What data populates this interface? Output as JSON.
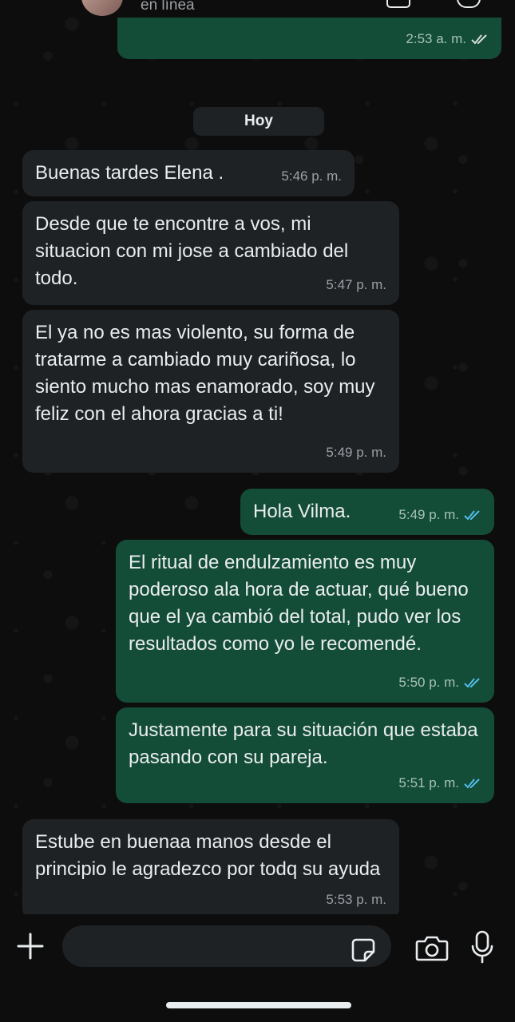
{
  "header": {
    "status": "en línea"
  },
  "date_separator": "Hoy",
  "messages": [
    {
      "direction": "out",
      "text": "",
      "time": "2:53 a. m."
    },
    {
      "direction": "in",
      "text": "Buenas tardes Elena .",
      "time": "5:46 p. m."
    },
    {
      "direction": "in",
      "text": "Desde que te encontre a vos, mi situacion con mi jose a cambiado del todo.",
      "time": "5:47 p. m."
    },
    {
      "direction": "in",
      "text": "El ya no es mas violento, su forma de tratarme a cambiado muy cariñosa, lo siento mucho mas enamorado, soy muy feliz con el ahora gracias a ti!",
      "time": "5:49 p. m."
    },
    {
      "direction": "out",
      "text": "Hola Vilma.",
      "time": "5:49 p. m."
    },
    {
      "direction": "out",
      "text": "El ritual de endulzamiento es muy poderoso ala hora de actuar, qué bueno que el ya cambió del total, pudo ver los resultados como yo le recomendé.",
      "time": "5:50 p. m."
    },
    {
      "direction": "out",
      "text": "Justamente para su situación que estaba pasando con su pareja.",
      "time": "5:51 p. m."
    },
    {
      "direction": "in",
      "text": "Estube en buenaa manos desde el principio le agradezco por todq su ayuda",
      "time": "5:53 p. m."
    }
  ],
  "input": {
    "placeholder": ""
  },
  "colors": {
    "incoming_bubble": "#1f2225",
    "outgoing_bubble": "#144d37",
    "read_ticks": "#53bdeb",
    "sent_ticks": "#d6dde0"
  }
}
